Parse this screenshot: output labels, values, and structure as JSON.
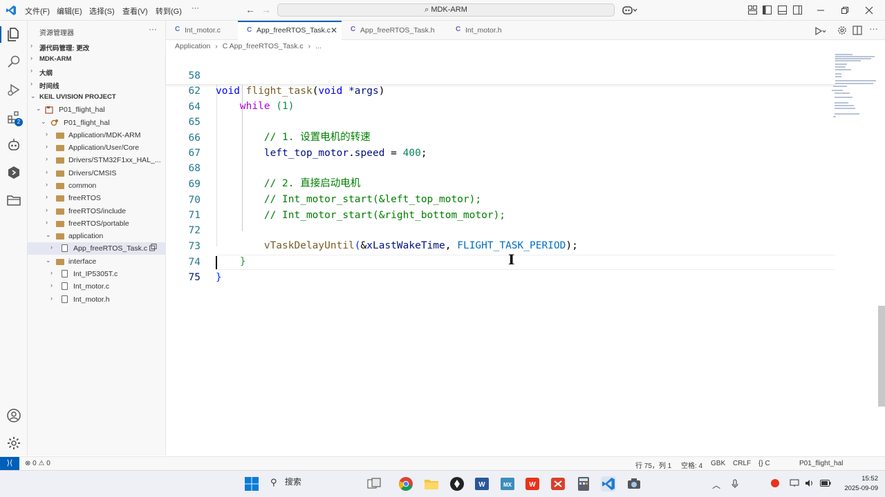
{
  "titlebar": {
    "menu": [
      "文件(F)",
      "编辑(E)",
      "选择(S)",
      "查看(V)",
      "转到(G)"
    ],
    "more": "···",
    "back": "←",
    "forward": "→",
    "search_text": "MDK-ARM"
  },
  "activity_badge": "2",
  "sidebar": {
    "title": "资源管理器",
    "more": "···",
    "sections": {
      "scm": "源代码管理: 更改",
      "mdk": "MDK-ARM",
      "outline": "大纲",
      "timeline": "时间线",
      "keil": "KEIL UVISION PROJECT"
    },
    "tree": [
      {
        "label": "P01_flight_hal"
      },
      {
        "label": "P01_flight_hal"
      },
      {
        "label": "Application/MDK-ARM"
      },
      {
        "label": "Application/User/Core"
      },
      {
        "label": "Drivers/STM32F1xx_HAL_..."
      },
      {
        "label": "Drivers/CMSIS"
      },
      {
        "label": "common"
      },
      {
        "label": "freeRTOS"
      },
      {
        "label": "freeRTOS/include"
      },
      {
        "label": "freeRTOS/portable"
      },
      {
        "label": "application"
      },
      {
        "label": "App_freeRTOS_Task.c"
      },
      {
        "label": "interface"
      },
      {
        "label": "Int_IP5305T.c"
      },
      {
        "label": "Int_motor.c"
      },
      {
        "label": "Int_motor.h"
      }
    ]
  },
  "tabs": [
    {
      "icon": "C",
      "label": "Int_motor.c"
    },
    {
      "icon": "C",
      "label": "App_freeRTOS_Task.c",
      "close": "✕"
    },
    {
      "icon": "C",
      "label": "App_freeRTOS_Task.h"
    },
    {
      "icon": "C",
      "label": "Int_motor.h"
    }
  ],
  "breadcrumb": {
    "part1": "Application",
    "sep": "›",
    "part2": "C App_freeRTOS_Task.c",
    "part3": "..."
  },
  "editor": {
    "lines": {
      "n58": "58",
      "n62": "62",
      "n64": "64",
      "n65": "65",
      "n66": "66",
      "n67": "67",
      "n68": "68",
      "n69": "69",
      "n70": "70",
      "n71": "71",
      "n72": "72",
      "n73": "73",
      "n74": "74",
      "n75": "75"
    },
    "code": {
      "l58_void": "void",
      "l58_fn": "flight_task",
      "l58_rest_open": "(",
      "l58_kw": "void",
      "l58_args": " *args",
      "l58_close": ")",
      "l62_while": "while",
      "l62_rest": " (1)",
      "l65": "// 1. 设置电机的转速",
      "l66_var": "left_top_motor",
      "l66_dot": ".",
      "l66_field": "speed",
      "l66_eq": " = ",
      "l66_num": "400",
      "l66_semi": ";",
      "l68": "// 2. 直接启动电机",
      "l69": "// Int_motor_start(&left_top_motor);",
      "l70": "// Int_motor_start(&right_bottom_motor);",
      "l72_fn": "vTaskDelayUntil",
      "l72_open": "(",
      "l72_amp": "&",
      "l72_var": "xLastWakeTime",
      "l72_comma": ", ",
      "l72_mac": "FLIGHT_TASK_PERIOD",
      "l72_close": ");",
      "l73": "}",
      "l74": "}"
    }
  },
  "statusbar": {
    "remote": "⟩⟨",
    "problems": "⊗ 0 ⚠ 0",
    "position": "行 75，列 1",
    "spaces": "空格: 4",
    "encoding": "GBK",
    "eol": "CRLF",
    "lang": "{} C",
    "project": "P01_flight_hal"
  },
  "taskbar": {
    "search": "搜索",
    "time": "15:52",
    "date": "2025-09-09"
  }
}
